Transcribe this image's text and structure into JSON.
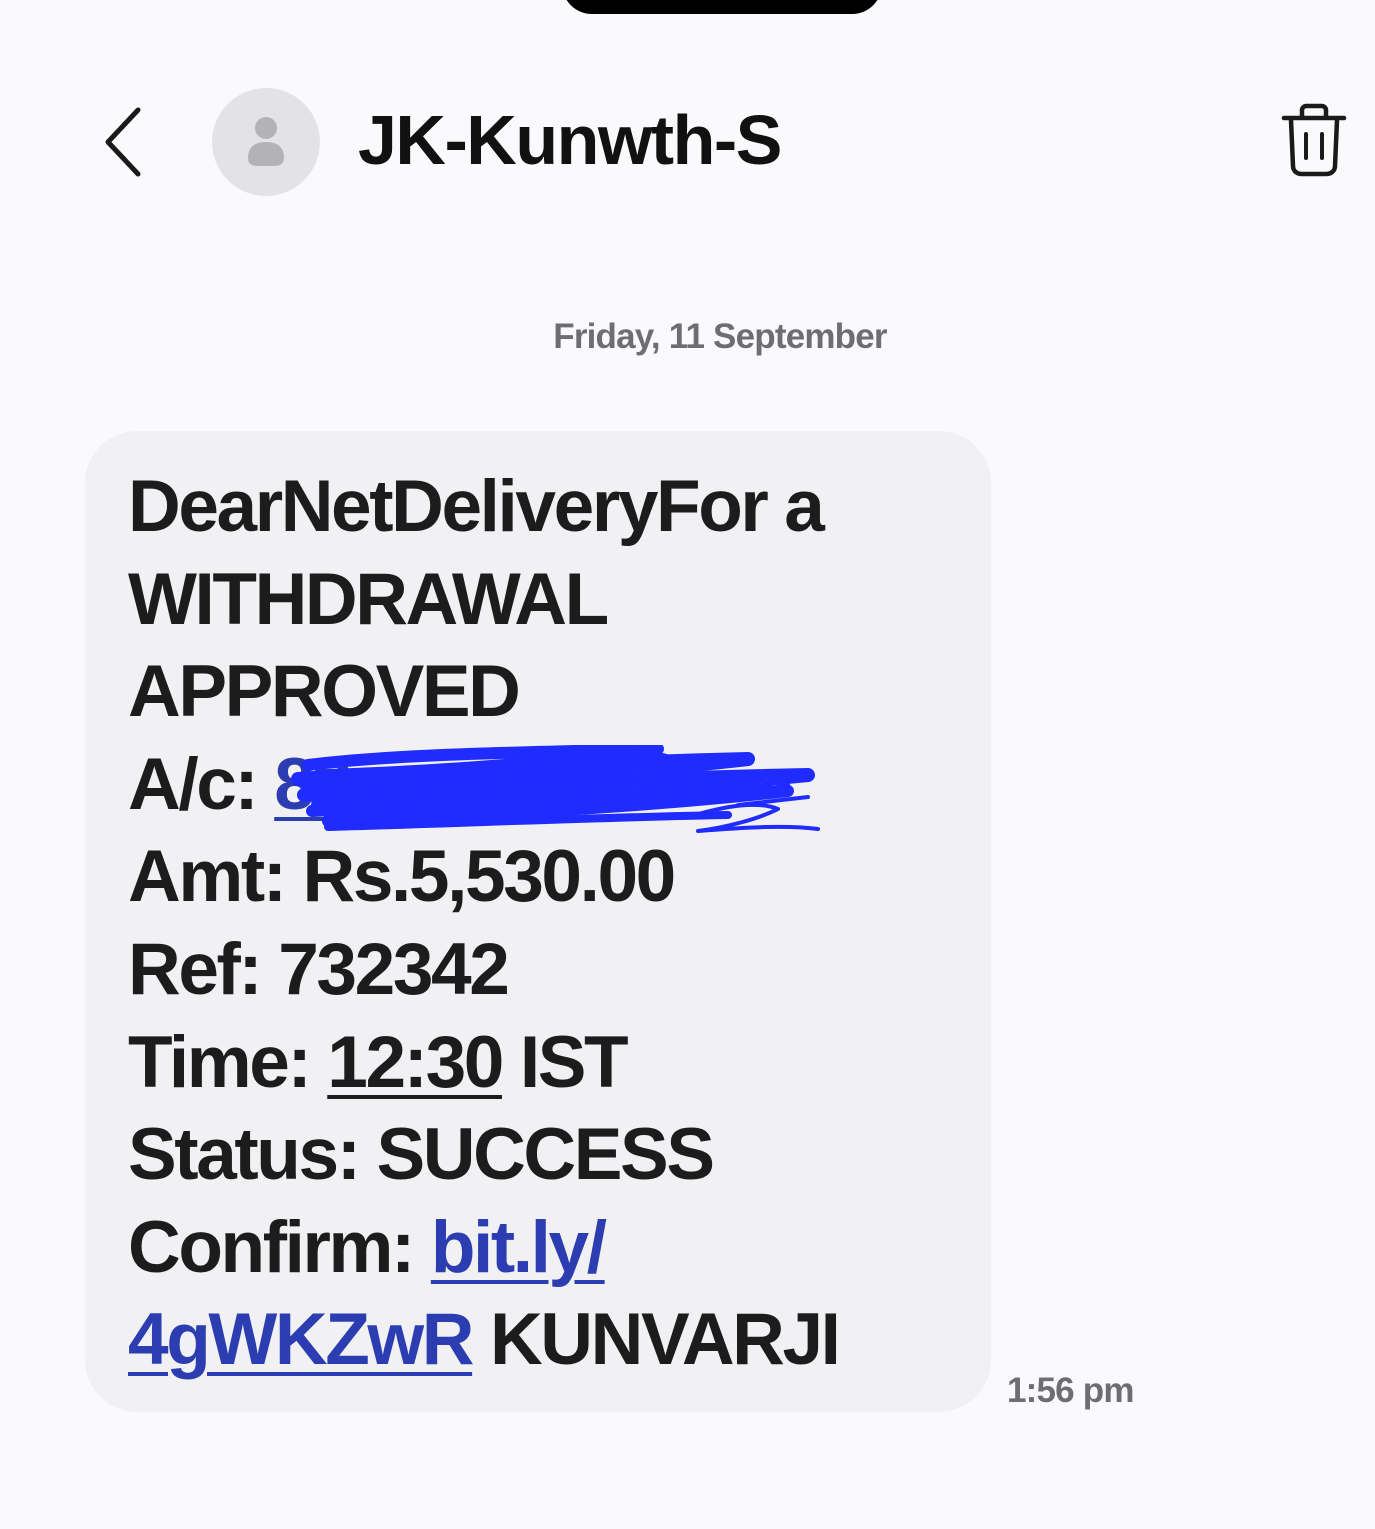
{
  "header": {
    "back_icon": "chevron-left-icon",
    "avatar_icon": "person-icon",
    "contact_name": "JK-Kunwth-S",
    "delete_icon": "trash-icon"
  },
  "conversation": {
    "date_separator": "Friday, 11 September",
    "message": {
      "line1": "DearNetDeliveryFor a",
      "line2": "WITHDRAWAL",
      "line3": "APPROVED",
      "account_label": "A/c: ",
      "account_value_visible": "89",
      "amount": "Amt: Rs.5,530.00",
      "ref": "Ref: 732342",
      "time_label": "Time: ",
      "time_value": "12:30",
      "time_zone": " IST",
      "status": "Status: SUCCESS",
      "confirm_label": "Confirm: ",
      "link_part1": "bit.ly/",
      "link_part2": "4gWKZwR",
      "sender_tag": " KUNVARJI",
      "redaction_color": "#1f2bff"
    },
    "message_time": "1:56 pm"
  },
  "colors": {
    "background": "#fafafc",
    "bubble": "#f1f1f3",
    "link": "#2b3db0",
    "meta_text": "#6e6e72"
  }
}
